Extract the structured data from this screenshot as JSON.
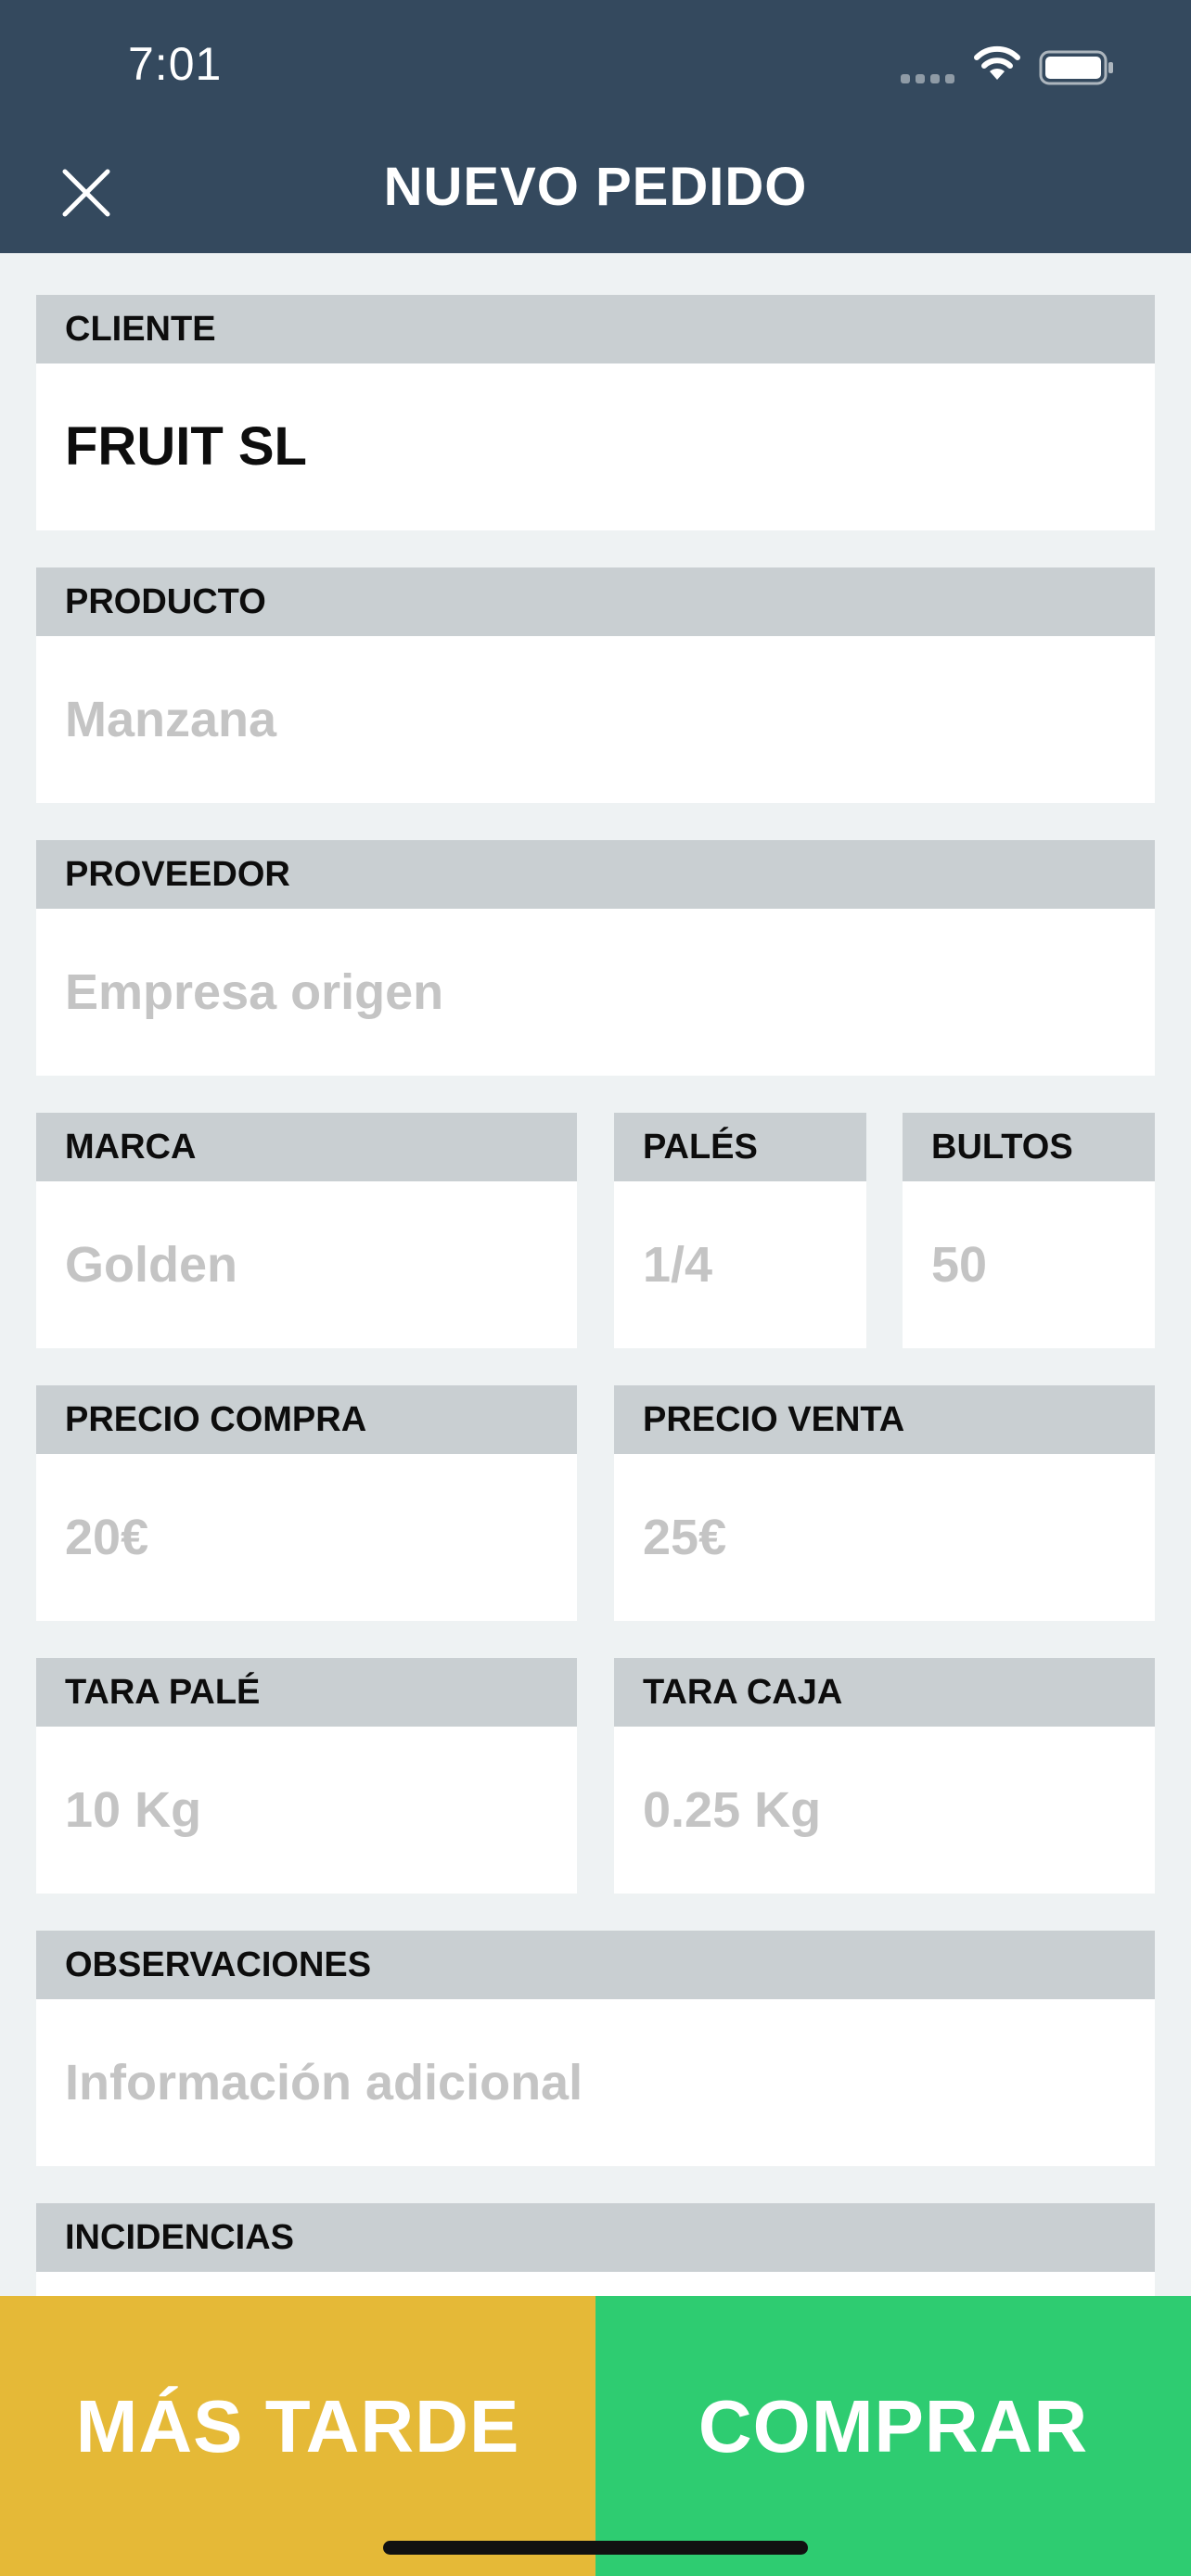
{
  "status_bar": {
    "time": "7:01"
  },
  "header": {
    "title": "NUEVO PEDIDO",
    "close_icon": "close-icon"
  },
  "form": {
    "cliente": {
      "label": "CLIENTE",
      "value": "FRUIT SL"
    },
    "producto": {
      "label": "PRODUCTO",
      "placeholder": "Manzana"
    },
    "proveedor": {
      "label": "PROVEEDOR",
      "placeholder": "Empresa origen"
    },
    "marca": {
      "label": "MARCA",
      "placeholder": "Golden"
    },
    "pales": {
      "label": "PALÉS",
      "placeholder": "1/4"
    },
    "bultos": {
      "label": "BULTOS",
      "placeholder": "50"
    },
    "precio_compra": {
      "label": "PRECIO COMPRA",
      "placeholder": "20€"
    },
    "precio_venta": {
      "label": "PRECIO VENTA",
      "placeholder": "25€"
    },
    "tara_pale": {
      "label": "TARA PALÉ",
      "placeholder": "10 Kg"
    },
    "tara_caja": {
      "label": "TARA CAJA",
      "placeholder": "0.25 Kg"
    },
    "observaciones": {
      "label": "OBSERVACIONES",
      "placeholder": "Información adicional"
    },
    "incidencias": {
      "label": "INCIDENCIAS"
    }
  },
  "actions": {
    "later_label": "MÁS TARDE",
    "buy_label": "COMPRAR"
  },
  "colors": {
    "header_bg": "#34495e",
    "label_bg": "#c9cfd2",
    "page_bg": "#eef2f3",
    "later_bg": "#e5b937",
    "buy_bg": "#2ecc71"
  }
}
